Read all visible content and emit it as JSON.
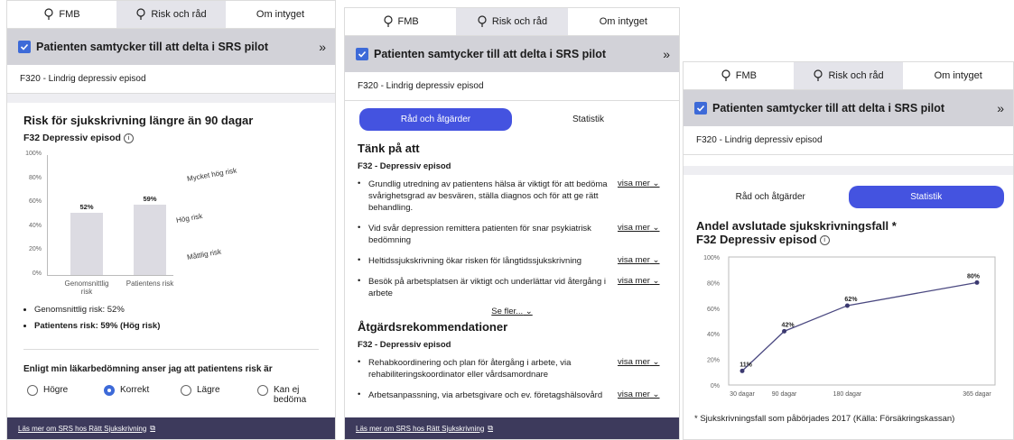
{
  "tabs": [
    "FMB",
    "Risk och råd",
    "Om intyget"
  ],
  "consent_label": "Patienten samtycker till att delta i SRS pilot",
  "expand_icon": "»",
  "diagnosis": "F320 - Lindrig depressiv episod",
  "footer_link": "Läs mer om SRS hos Rätt Sjukskrivning",
  "colors": {
    "accent": "#4453e0",
    "footer": "#3d3a5c",
    "consent_bg": "#d2d2d8"
  },
  "panel1": {
    "title": "Risk för sjukskrivning längre än 90 dagar",
    "subtitle": "F32 Depressiv episod",
    "risk_levels": [
      "Mycket hög risk",
      "Hög risk",
      "Måttlig risk"
    ],
    "summary": [
      "Genomsnittlig risk: 52%",
      "Patientens risk: 59% (Hög risk)"
    ],
    "assessment_question": "Enligt min läkarbedömning anser jag att patientens risk är",
    "options": [
      "Högre",
      "Korrekt",
      "Lägre",
      "Kan ej bedöma"
    ],
    "selected_option": "Korrekt"
  },
  "panel2": {
    "seg_options": [
      "Råd och åtgärder",
      "Statistik"
    ],
    "section1_title": "Tänk på att",
    "section_subtitle": "F32 - Depressiv episod",
    "advice": [
      "Grundlig utredning av patientens hälsa är viktigt för att bedöma svårighetsgrad av besvären, ställa diagnos och för att ge rätt behandling.",
      "Vid svår depression remittera patienten för snar psykiatrisk bedömning",
      "Heltidssjukskrivning ökar risken för långtidssjukskrivning",
      "Besök på arbetsplatsen är viktigt och underlättar vid återgång i arbete"
    ],
    "show_more_label": "visa mer",
    "see_more_label": "Se fler...",
    "section2_title": "Åtgärdsrekommendationer",
    "recommendations": [
      "Rehabkoordinering och plan för återgång i arbete, via rehabiliteringskoordinator eller vårdsamordnare",
      "Arbetsanpassning, via arbetsgivare och ev. företagshälsovård"
    ]
  },
  "panel3": {
    "seg_options": [
      "Råd och åtgärder",
      "Statistik"
    ],
    "title": "Andel avslutade sjukskrivningsfall *",
    "subtitle": "F32 Depressiv episod",
    "footnote": "* Sjukskrivningsfall som påbörjades 2017 (Källa: Försäkringskassan)"
  },
  "chart_data": [
    {
      "type": "bar",
      "categories": [
        "Genomsnittlig risk",
        "Patientens risk"
      ],
      "values": [
        52,
        59
      ],
      "data_labels": [
        "52%",
        "59%"
      ],
      "ylim": [
        0,
        100
      ],
      "yticks": [
        "0%",
        "20%",
        "40%",
        "60%",
        "80%",
        "100%"
      ],
      "risk_bands": [
        "Måttlig risk",
        "Hög risk",
        "Mycket hög risk"
      ],
      "grid": false
    },
    {
      "type": "line",
      "x": [
        30,
        90,
        180,
        365
      ],
      "x_labels": [
        "30 dagar",
        "90 dagar",
        "180 dagar",
        "365 dagar"
      ],
      "values": [
        11,
        42,
        62,
        80
      ],
      "data_labels": [
        "11%",
        "42%",
        "62%",
        "80%"
      ],
      "ylim": [
        0,
        100
      ],
      "yticks": [
        "0%",
        "20%",
        "40%",
        "60%",
        "80%",
        "100%"
      ],
      "grid": false
    }
  ]
}
